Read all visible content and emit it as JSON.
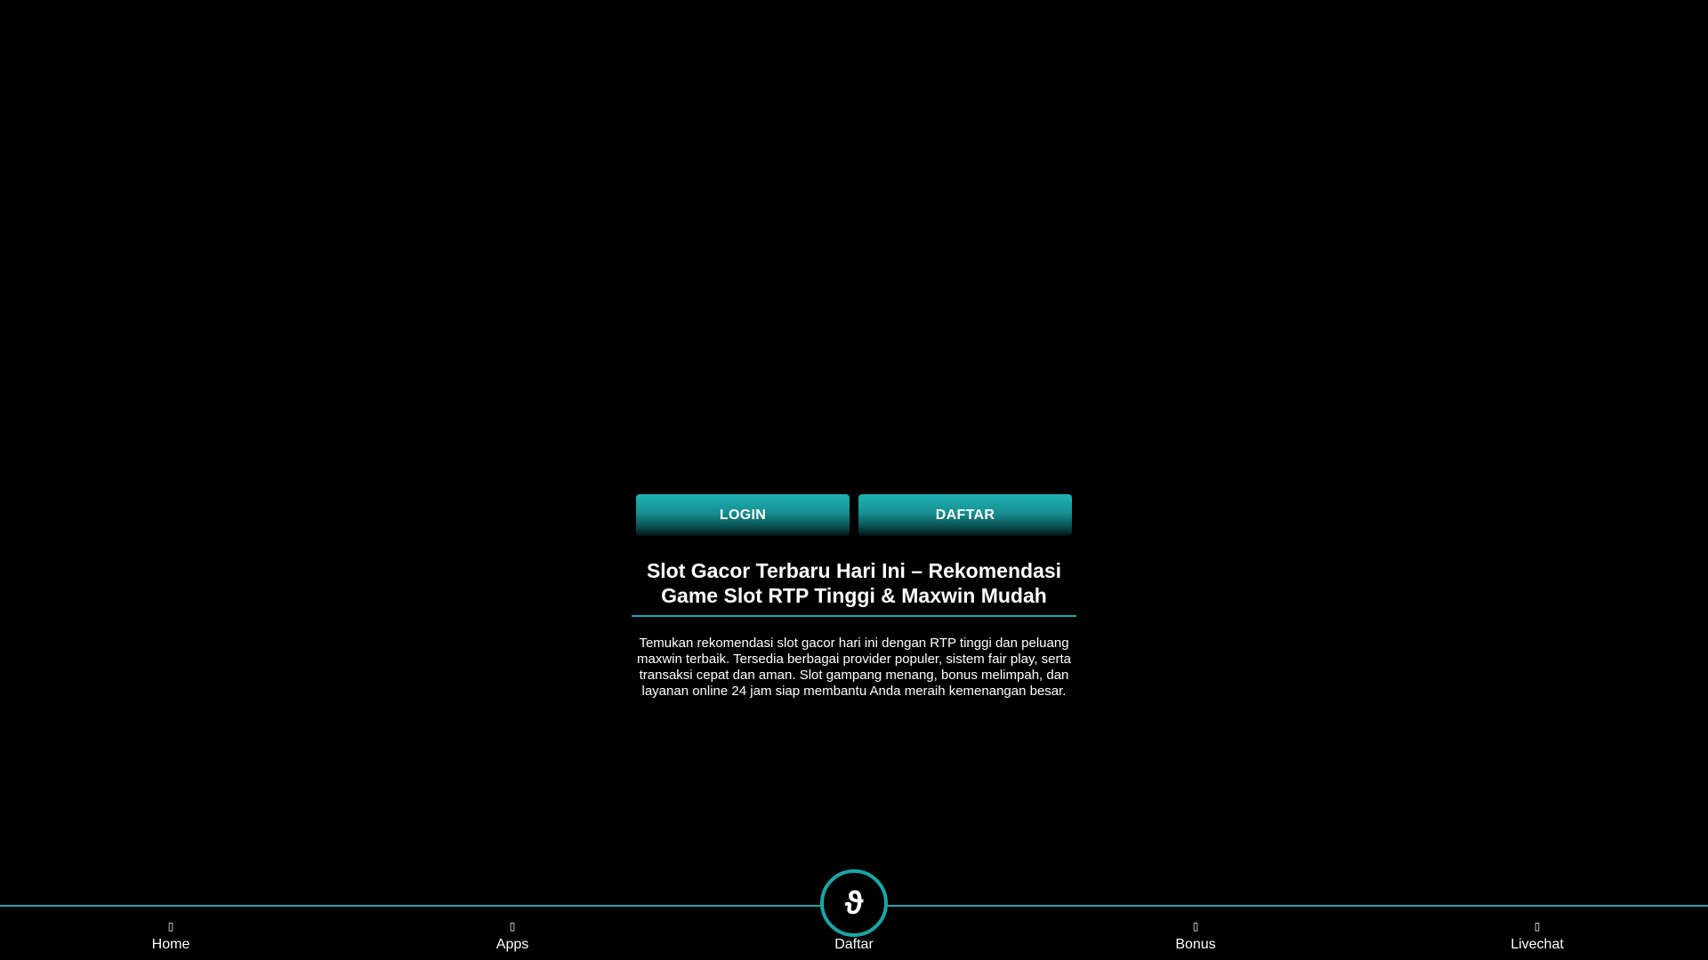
{
  "auth": {
    "login_label": "LOGIN",
    "daftar_label": "DAFTAR"
  },
  "main": {
    "title": "Slot Gacor Terbaru Hari Ini – Rekomendasi Game Slot RTP Tinggi & Maxwin Mudah",
    "description": "Temukan rekomendasi slot gacor hari ini dengan RTP tinggi dan peluang maxwin terbaik. Tersedia berbagai provider populer, sistem fair play, serta transaksi cepat dan aman. Slot gampang menang, bonus melimpah, dan layanan online 24 jam siap membantu Anda meraih kemenangan besar."
  },
  "bottom_nav": {
    "center_fab_glyph": "ϑ",
    "items": [
      {
        "label": "Home",
        "icon": "home-icon",
        "glyph": "▯"
      },
      {
        "label": "Apps",
        "icon": "apps-icon",
        "glyph": "▯"
      },
      {
        "label": "Daftar",
        "icon": "daftar-icon",
        "glyph": ""
      },
      {
        "label": "Bonus",
        "icon": "bonus-icon",
        "glyph": "▯"
      },
      {
        "label": "Livechat",
        "icon": "livechat-icon",
        "glyph": "▯"
      }
    ]
  },
  "colors": {
    "background": "#000000",
    "accent": "#1aa6a6",
    "button_top": "#1fb3b3",
    "text": "#ffffff"
  }
}
